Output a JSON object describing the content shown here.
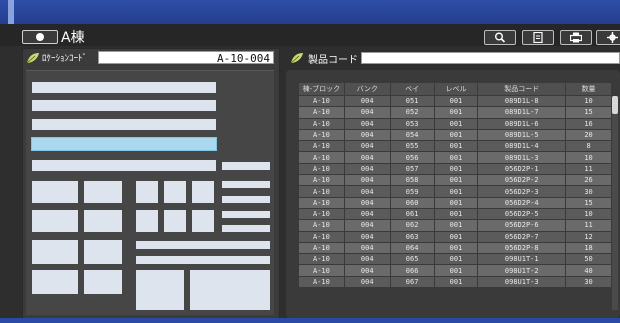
{
  "header": {
    "title": "A棟"
  },
  "toolbar": {
    "search_icon": "search-icon",
    "doc_icon": "document-icon",
    "print_icon": "print-icon",
    "settings_icon": "gear-icon"
  },
  "location": {
    "label": "ﾛｹｰｼｮﾝｺｰﾄﾞ",
    "value": "A-10-004"
  },
  "product": {
    "label": "製品コード",
    "value": ""
  },
  "table": {
    "columns": [
      "棟-ブロック",
      "バンク",
      "ベイ",
      "レベル",
      "製品コード",
      "数量"
    ],
    "rows": [
      [
        "A-10",
        "004",
        "051",
        "001",
        "089D1L-8",
        "10"
      ],
      [
        "A-10",
        "004",
        "052",
        "001",
        "089D1L-7",
        "15"
      ],
      [
        "A-10",
        "004",
        "053",
        "001",
        "089D1L-6",
        "16"
      ],
      [
        "A-10",
        "004",
        "054",
        "001",
        "089D1L-5",
        "20"
      ],
      [
        "A-10",
        "004",
        "055",
        "001",
        "089D1L-4",
        "8"
      ],
      [
        "A-10",
        "004",
        "056",
        "001",
        "089D1L-3",
        "10"
      ],
      [
        "A-10",
        "004",
        "057",
        "001",
        "056D2P-1",
        "11"
      ],
      [
        "A-10",
        "004",
        "058",
        "001",
        "056D2P-2",
        "26"
      ],
      [
        "A-10",
        "004",
        "059",
        "001",
        "056D2P-3",
        "30"
      ],
      [
        "A-10",
        "004",
        "060",
        "001",
        "056D2P-4",
        "15"
      ],
      [
        "A-10",
        "004",
        "061",
        "001",
        "056D2P-5",
        "10"
      ],
      [
        "A-10",
        "004",
        "062",
        "001",
        "056D2P-6",
        "11"
      ],
      [
        "A-10",
        "004",
        "063",
        "001",
        "056D2P-7",
        "12"
      ],
      [
        "A-10",
        "004",
        "064",
        "001",
        "056D2P-8",
        "18"
      ],
      [
        "A-10",
        "004",
        "065",
        "001",
        "098U1T-1",
        "50"
      ],
      [
        "A-10",
        "004",
        "066",
        "001",
        "098U1T-2",
        "40"
      ],
      [
        "A-10",
        "004",
        "067",
        "001",
        "098U1T-3",
        "30"
      ]
    ]
  }
}
